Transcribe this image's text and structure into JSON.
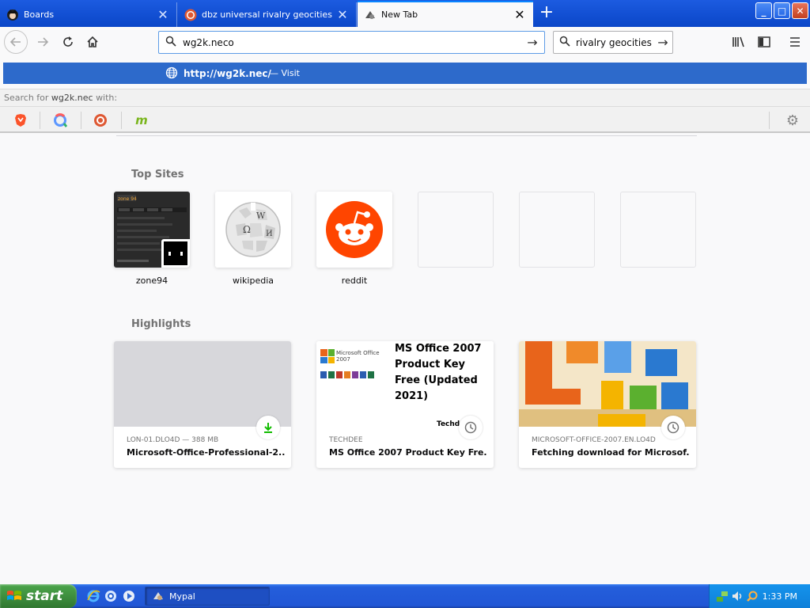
{
  "tabs": [
    {
      "title": "Boards"
    },
    {
      "title": "dbz universal rivalry geocities at DuckDuckGo"
    },
    {
      "title": "New Tab"
    }
  ],
  "window_controls": {
    "minimize": "_",
    "maximize": "□",
    "close": "✕"
  },
  "toolbar": {
    "url_value": "wg2k.neco",
    "search_value": "rivalry geocities"
  },
  "suggestion": {
    "url": "http://wg2k.nec/",
    "action": "— Visit"
  },
  "search_for": {
    "prefix": "Search for",
    "query": "wg2k.nec",
    "suffix": "with:"
  },
  "newtab": {
    "top_sites_title": "Top Sites",
    "highlights_title": "Highlights",
    "top_sites": [
      {
        "label": "zone94"
      },
      {
        "label": "wikipedia"
      },
      {
        "label": "reddit"
      }
    ],
    "highlights": [
      {
        "context": "LON-01.DLO4D — 388 MB",
        "title": "Microsoft-Office-Professional-2...",
        "badge": "download-icon"
      },
      {
        "context": "TECHDEE",
        "title": "MS Office 2007 Product Key Fre...",
        "badge": "clock-icon",
        "thumb_heading": "MS Office 2007 Product Key Free (Updated 2021)",
        "thumb_logo": "Microsoft Office 2007",
        "thumb_tail": "Techd"
      },
      {
        "context": "MICROSOFT-OFFICE-2007.EN.LO4D",
        "title": "Fetching download for Microsof...",
        "badge": "clock-icon"
      }
    ]
  },
  "taskbar": {
    "start_label": "start",
    "task_label": "Mypal",
    "clock": "1:33 PM"
  },
  "colors": {
    "accent": "#2d6acb",
    "taskbar": "#245edb",
    "start": "#3c8a3c",
    "reddit": "#ff4500"
  }
}
